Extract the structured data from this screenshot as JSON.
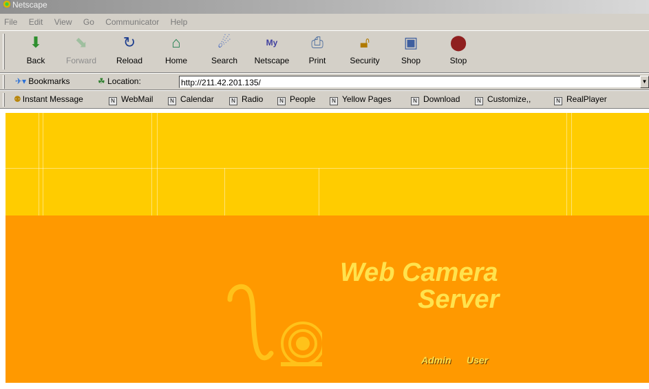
{
  "window": {
    "title": "Netscape"
  },
  "menu": [
    "File",
    "Edit",
    "View",
    "Go",
    "Communicator",
    "Help"
  ],
  "toolbar": {
    "buttons": [
      {
        "label": "Back",
        "icon": "back-arrow-icon",
        "enabled": true
      },
      {
        "label": "Forward",
        "icon": "forward-arrow-icon",
        "enabled": false
      },
      {
        "label": "Reload",
        "icon": "reload-icon",
        "enabled": true
      },
      {
        "label": "Home",
        "icon": "home-icon",
        "enabled": true
      },
      {
        "label": "Search",
        "icon": "search-icon",
        "enabled": true
      },
      {
        "label": "Netscape",
        "icon": "my-netscape-icon",
        "enabled": true
      },
      {
        "label": "Print",
        "icon": "printer-icon",
        "enabled": true
      },
      {
        "label": "Security",
        "icon": "padlock-icon",
        "enabled": true
      },
      {
        "label": "Shop",
        "icon": "shop-icon",
        "enabled": true
      },
      {
        "label": "Stop",
        "icon": "stop-light-icon",
        "enabled": true
      }
    ]
  },
  "location": {
    "bookmarks_label": "Bookmarks",
    "location_label": "Location:",
    "url": "http://211.42.201.135/"
  },
  "personal_toolbar": {
    "items": [
      "Instant Message",
      "WebMail",
      "Calendar",
      "Radio",
      "People",
      "Yellow Pages",
      "Download",
      "Customize,,",
      "RealPlayer"
    ]
  },
  "page": {
    "title_line1": "Web Camera",
    "title_line2": "Server",
    "admin_link": "Admin",
    "user_link": "User",
    "colors": {
      "top_band": "#ffcc00",
      "main_band": "#ff9900",
      "title": "#ffe24d"
    }
  }
}
